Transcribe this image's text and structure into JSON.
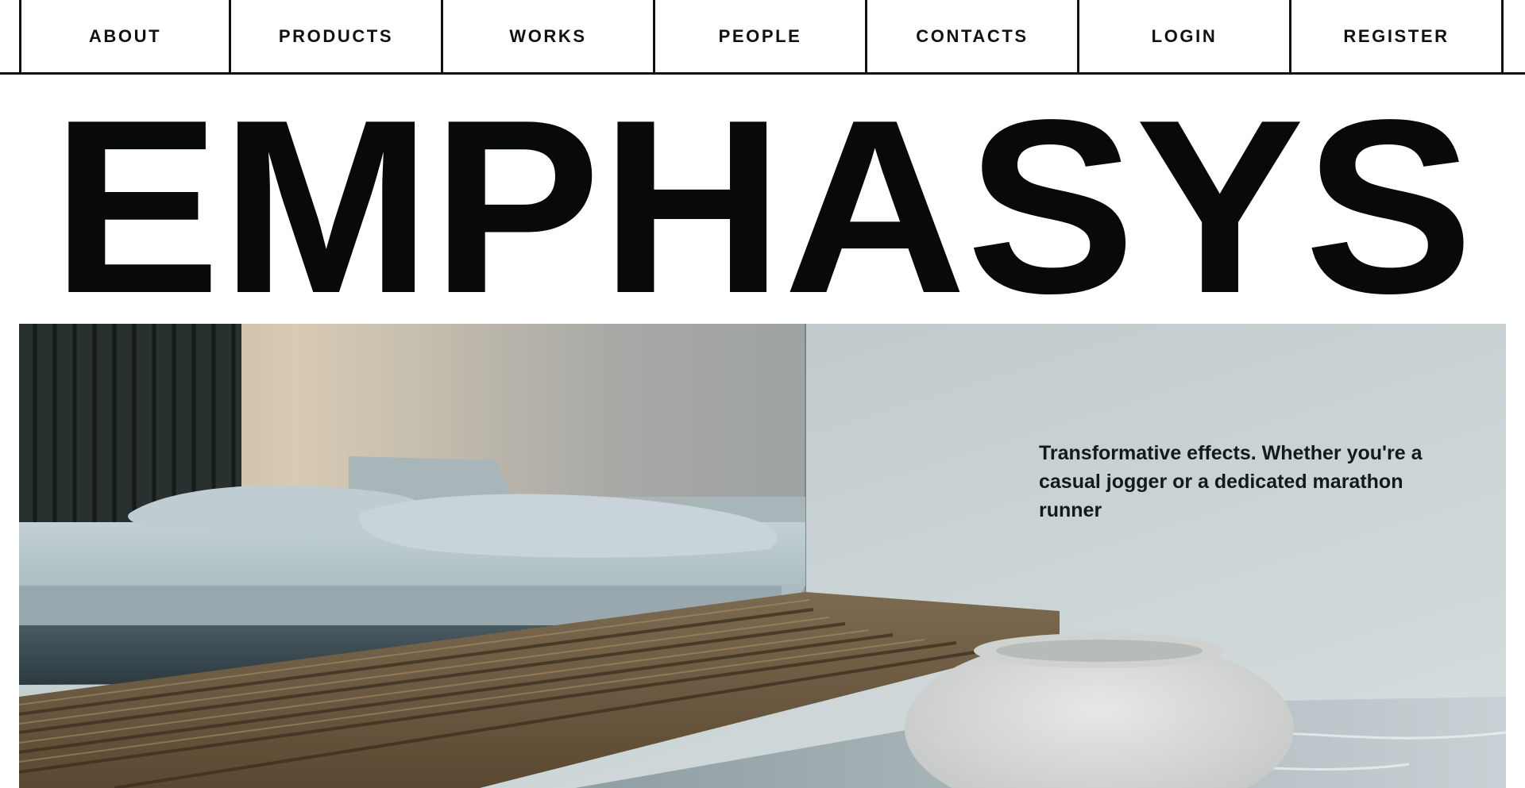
{
  "nav": {
    "items": [
      {
        "label": "ABOUT"
      },
      {
        "label": "PRODUCTS"
      },
      {
        "label": "WORKS"
      },
      {
        "label": "PEOPLE"
      },
      {
        "label": "CONTACTS"
      },
      {
        "label": "LOGIN"
      },
      {
        "label": "REGISTER"
      }
    ]
  },
  "hero": {
    "brand": "EMPHASYS",
    "tagline": "Transformative effects. Whether you're a casual jogger or a dedicated marathon runner"
  },
  "colors": {
    "text": "#080909",
    "border": "#111111",
    "background": "#ffffff"
  }
}
